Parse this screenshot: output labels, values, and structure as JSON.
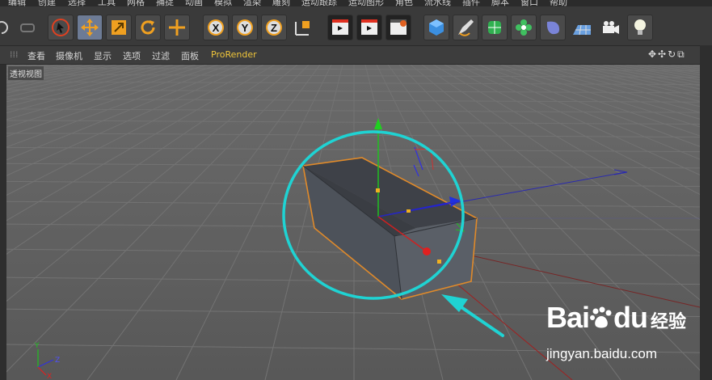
{
  "menu": [
    "编辑",
    "创建",
    "选择",
    "工具",
    "网格",
    "捕捉",
    "动画",
    "模拟",
    "渲染",
    "雕刻",
    "运动跟踪",
    "运动图形",
    "角色",
    "流水线",
    "插件",
    "脚本",
    "窗口",
    "帮助"
  ],
  "toolbar_icons": [
    "undo-icon",
    "redo-icon",
    "live-select-icon",
    "move-icon",
    "scale-icon",
    "rotate-icon",
    "add-icon",
    "x-axis-lock-icon",
    "y-axis-lock-icon",
    "z-axis-lock-icon",
    "coordinate-system-icon",
    "render-view-icon",
    "render-picture-queue-icon",
    "render-settings-icon",
    "cube-icon",
    "pen-icon",
    "subdivision-icon",
    "cloner-icon",
    "deformer-icon",
    "floor-icon",
    "camera-icon",
    "light-icon"
  ],
  "toolbar_axes": [
    "X",
    "Y",
    "Z"
  ],
  "viewport_menu": {
    "items": [
      "查看",
      "摄像机",
      "显示",
      "选项",
      "过滤",
      "面板"
    ],
    "prorender": "ProRender"
  },
  "viewport": {
    "label": "透视视图",
    "axis_labels": {
      "y": "Y",
      "z": "Z",
      "x": "X"
    }
  },
  "watermark": {
    "brand": "Bai",
    "brand_suffix": "du",
    "cn": "经验",
    "url": "jingyan.baidu.com"
  },
  "colors": {
    "annotation": "#1fd3d3",
    "selection": "#e08a2a",
    "axis_x": "#e02020",
    "axis_y": "#20d020",
    "axis_z": "#2030e0"
  }
}
